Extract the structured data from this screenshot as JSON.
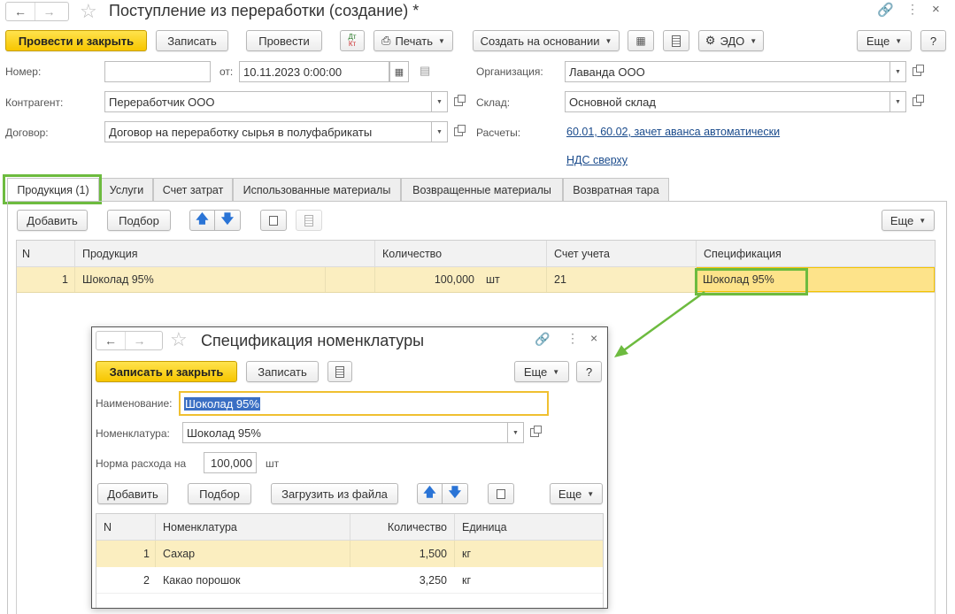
{
  "window": {
    "title": "Поступление из переработки (создание) *"
  },
  "toolbar": {
    "post_close": "Провести и закрыть",
    "save": "Записать",
    "post": "Провести",
    "dt_kt": "Дт Кт",
    "print": "Печать",
    "create_based": "Создать на основании",
    "edo": "ЭДО",
    "more": "Еще",
    "help": "?"
  },
  "form": {
    "number_label": "Номер:",
    "number_value": "",
    "date_label": "от:",
    "date_value": "10.11.2023  0:00:00",
    "org_label": "Организация:",
    "org_value": "Лаванда ООО",
    "contractor_label": "Контрагент:",
    "contractor_value": "Переработчик ООО",
    "warehouse_label": "Склад:",
    "warehouse_value": "Основной склад",
    "contract_label": "Договор:",
    "contract_value": "Договор на переработку сырья в полуфабрикаты",
    "settlements_label": "Расчеты:",
    "settlements_link": "60.01, 60.02, зачет аванса автоматически",
    "vat_link": "НДС сверху"
  },
  "tabs": [
    {
      "label": "Продукция (1)"
    },
    {
      "label": "Услуги"
    },
    {
      "label": "Счет затрат"
    },
    {
      "label": "Использованные материалы"
    },
    {
      "label": "Возвращенные материалы"
    },
    {
      "label": "Возвратная тара"
    }
  ],
  "table_toolbar": {
    "add": "Добавить",
    "pick": "Подбор",
    "more": "Еще"
  },
  "products_table": {
    "columns": [
      "N",
      "Продукция",
      "Количество",
      "Счет учета",
      "Спецификация"
    ],
    "rows": [
      {
        "n": "1",
        "product": "Шоколад 95%",
        "qty": "100,000",
        "unit": "шт",
        "account": "21",
        "spec": "Шоколад 95%"
      }
    ]
  },
  "dialog": {
    "title": "Спецификация номенклатуры",
    "save_close": "Записать и закрыть",
    "save": "Записать",
    "more": "Еще",
    "help": "?",
    "name_label": "Наименование:",
    "name_value": "Шоколад 95%",
    "item_label": "Номенклатура:",
    "item_value": "Шоколад 95%",
    "norm_label": "Норма расхода на",
    "norm_value": "100,000",
    "norm_unit": "шт",
    "add": "Добавить",
    "pick": "Подбор",
    "load_file": "Загрузить из файла",
    "table_more": "Еще",
    "columns": [
      "N",
      "Номенклатура",
      "Количество",
      "Единица"
    ],
    "rows": [
      {
        "n": "1",
        "item": "Сахар",
        "qty": "1,500",
        "unit": "кг"
      },
      {
        "n": "2",
        "item": "Какао порошок",
        "qty": "3,250",
        "unit": "кг"
      }
    ]
  },
  "colors": {
    "accent_yellow": "#f7c600",
    "selected_row": "#fbeec0",
    "highlight_green": "#6dbb3f",
    "link": "#1a4b8c"
  }
}
